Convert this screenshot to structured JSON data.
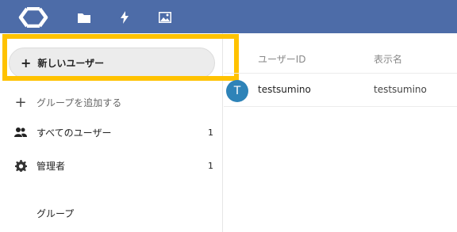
{
  "header": {
    "accent_color": "#4d6ca8",
    "logo_icon": "nextcloud-logo-icon",
    "apps": [
      {
        "icon": "folder-icon"
      },
      {
        "icon": "lightning-icon"
      },
      {
        "icon": "image-icon"
      }
    ]
  },
  "sidebar": {
    "new_user_button": {
      "plus": "+",
      "label": "新しいユーザー"
    },
    "add_group": {
      "icon": "+",
      "label": "グループを追加する"
    },
    "items": [
      {
        "label": "すべてのユーザー",
        "count": "1",
        "icon": "users-icon"
      },
      {
        "label": "管理者",
        "count": "1",
        "icon": "gear-icon"
      }
    ],
    "groups_header": "グループ"
  },
  "table": {
    "columns": {
      "user_id": "ユーザーID",
      "display_name": "表示名"
    },
    "rows": [
      {
        "avatar_initial": "T",
        "user_id": "testsumino",
        "display_name": "testsumino"
      }
    ]
  },
  "highlight_color": "#ffc200"
}
